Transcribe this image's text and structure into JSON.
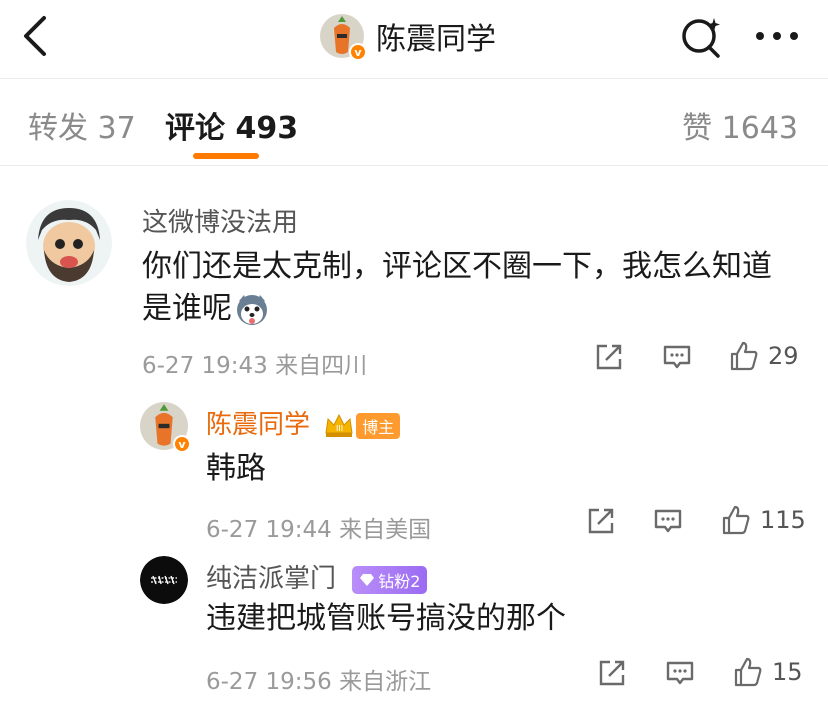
{
  "header": {
    "title": "陈震同学"
  },
  "tabs": [
    {
      "label": "转发 37"
    },
    {
      "label": "评论 493"
    },
    {
      "label": "赞 1643"
    }
  ],
  "comments": [
    {
      "name": "这微博没法用",
      "text_line1": "你们还是太克制，评论区不圈一下，我怎么知道",
      "text_line2": "是谁呢",
      "meta": "6-27 19:43  来自四川",
      "likes": "29"
    },
    {
      "name": "陈震同学",
      "badge": "博主",
      "text": "韩路",
      "meta": "6-27 19:44  来自美国",
      "likes": "115"
    },
    {
      "name": "纯洁派掌门",
      "badge": "钻粉2",
      "text": "违建把城管账号搞没的那个",
      "meta": "6-27 19:56  来自浙江",
      "likes": "15"
    }
  ],
  "colors": {
    "accent": "#ff7a00",
    "author_name": "#e86a0c",
    "user_name": "#555555",
    "muted": "#9a9a9a"
  },
  "icons": [
    "back-arrow-icon",
    "search-sparkle-icon",
    "more-dots-icon",
    "repost-icon",
    "comment-icon",
    "thumbs-up-icon",
    "husky-emoji-icon",
    "crown-icon",
    "diamond-icon"
  ]
}
